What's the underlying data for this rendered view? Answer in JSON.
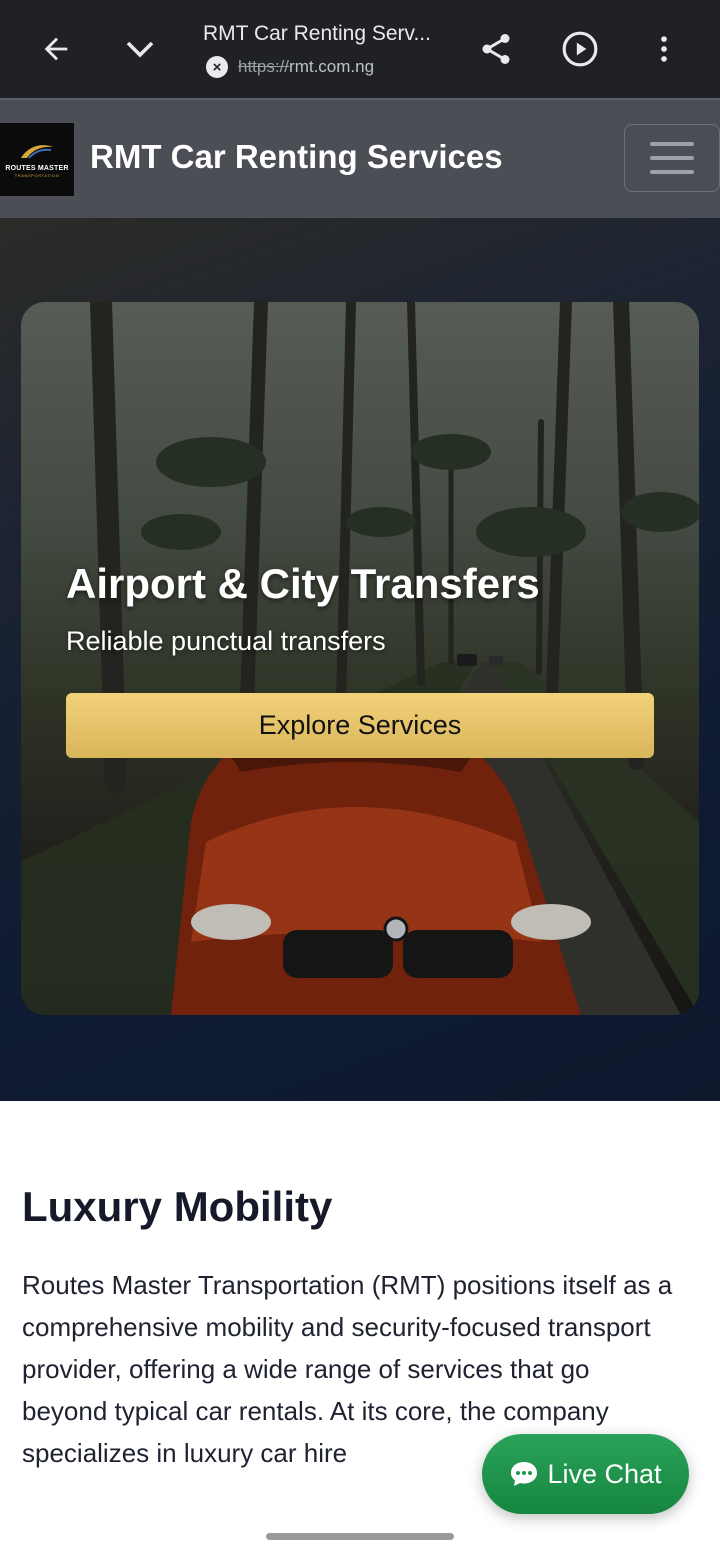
{
  "browser": {
    "tab_title": "RMT Car Renting Serv...",
    "url_scheme": "https://",
    "url_host": "rmt.com.ng",
    "icons": {
      "back": "back-arrow-icon",
      "tabs": "chevron-down-icon",
      "share": "share-icon",
      "play": "play-icon",
      "menu": "more-vert-icon",
      "insecure": "close-icon"
    }
  },
  "navbar": {
    "logo_text": "ROUTES MASTER",
    "logo_subtext": "TRANSPORTATION",
    "brand": "RMT Car Renting Services",
    "toggler_icon": "hamburger-icon"
  },
  "hero": {
    "title": "Airport & City Transfers",
    "subtitle": "Reliable punctual transfers",
    "button_label": "Explore Services"
  },
  "content": {
    "heading": "Luxury Mobility",
    "body": "Routes Master Transportation (RMT) positions itself as a comprehensive mobility and security-focused transport provider, offering a wide range of services that go beyond typical car rentals. At its core, the company specializes in luxury car hire"
  },
  "live_chat": {
    "label": "Live Chat",
    "icon": "chat-bubble-icon"
  },
  "colors": {
    "accent_gold": "#e6c46a",
    "chat_green": "#1f9a4e",
    "navbar": "#4b4e55",
    "hero_bg": "#0f1b33"
  }
}
